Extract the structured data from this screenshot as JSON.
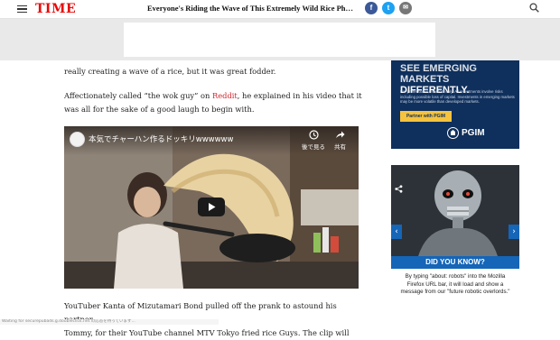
{
  "header": {
    "logo": "TIME",
    "headline": "Everyone's Riding the Wave of This Extremely Wild Rice Photo. Her...",
    "share_facebook": "f",
    "share_twitter": "t",
    "share_email": "✉"
  },
  "article": {
    "p1": "really creating a wave of a rice, but it was great fodder.",
    "p2_before": "Affectionately called “the wok guy” on ",
    "p2_link": "Reddit",
    "p2_line1_after": ", he explained in his video that it",
    "p2_line2": "was all for the sake of a good laugh to begin with.",
    "p3_line1": "YouTuber Kanta of Mizutamari Bond pulled off the prank to astound his partner",
    "p3_line2": "Tommy, for their YouTube channel MTV Tokyo fried rice Guys. The clip will"
  },
  "video": {
    "title": "本気でチャーハン作るドッキリwwwwww",
    "watch_later_label": "後で見る",
    "share_label": "共有"
  },
  "sidebar_ad1": {
    "headline_line1": "SEE EMERGING MARKETS",
    "headline_line2": "DIFFERENTLY.",
    "small_print": "For professional investors only. All investments involve risks including possible loss of capital. Investments in emerging markets may be more volatile than developed markets.",
    "cta": "Partner with PGIM",
    "brand": "PGIM"
  },
  "sidebar_ad2": {
    "title": "DID YOU KNOW?",
    "body": "By typing \"about: robots\" into the Mozilla Firefox URL bar, it will load and show a message from our \"future robotic overlords.\"",
    "prev_arrow": "‹",
    "next_arrow": "›"
  },
  "statusbar": {
    "text": "Waiting for securepubads.g.doubleclick.net の応答を待っています..."
  },
  "colors": {
    "brand_red": "#e90606",
    "link_red": "#d2252b",
    "facebook": "#3b5998",
    "twitter": "#1da1f2",
    "email": "#777777",
    "pgim_navy": "#0f2f5c",
    "pgim_gold": "#f5c33e",
    "dyk_blue": "#1565b8"
  },
  "icons": {
    "menu": "hamburger-icon",
    "search": "search-icon",
    "play": "play-icon",
    "clock": "clock-icon",
    "share": "share-arrow-icon"
  }
}
